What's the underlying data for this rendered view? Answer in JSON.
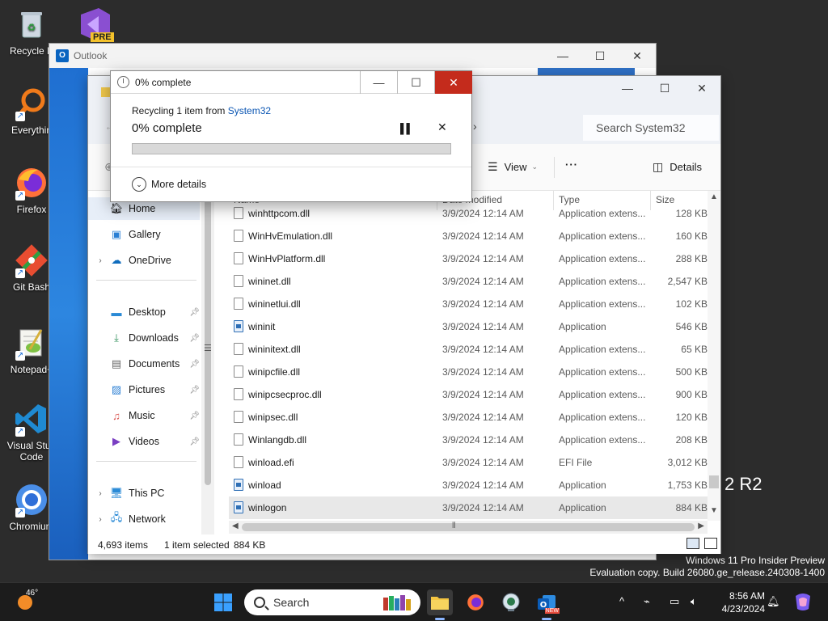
{
  "desktop": {
    "icons": [
      {
        "label": "Recycle B",
        "icon": "recycle-bin-icon"
      },
      {
        "label": "Everythin",
        "icon": "everything-search-icon"
      },
      {
        "label": "Firefox",
        "icon": "firefox-icon"
      },
      {
        "label": "Git Bash",
        "icon": "git-bash-icon"
      },
      {
        "label": "Notepad+",
        "icon": "notepad-plus-icon"
      },
      {
        "label": "Visual Stud Code",
        "icon": "vscode-icon"
      },
      {
        "label": "Chromium",
        "icon": "chromium-icon"
      }
    ],
    "vs_badge": "PRE",
    "background_text": "2 R2",
    "watermark": {
      "line1": "Windows 11 Pro Insider Preview",
      "line2": "Evaluation copy. Build 26080.ge_release.240308-1400"
    }
  },
  "outlook": {
    "title": "Outlook",
    "icon_letter": "O"
  },
  "explorer": {
    "search_placeholder": "Search System32",
    "toolbar": {
      "view_label": "View",
      "more_label": "···",
      "details_label": "Details"
    },
    "nav": {
      "home": "Home",
      "gallery": "Gallery",
      "onedrive": "OneDrive",
      "desktop": "Desktop",
      "downloads": "Downloads",
      "documents": "Documents",
      "pictures": "Pictures",
      "music": "Music",
      "videos": "Videos",
      "thispc": "This PC",
      "network": "Network"
    },
    "columns": {
      "name": "Name",
      "date": "Date modified",
      "type": "Type",
      "size": "Size"
    },
    "files": [
      {
        "name": "winhttpcom.dll",
        "date": "3/9/2024 12:14 AM",
        "type": "Application extens...",
        "size": "128 KB",
        "kind": "dll"
      },
      {
        "name": "WinHvEmulation.dll",
        "date": "3/9/2024 12:14 AM",
        "type": "Application extens...",
        "size": "160 KB",
        "kind": "dll"
      },
      {
        "name": "WinHvPlatform.dll",
        "date": "3/9/2024 12:14 AM",
        "type": "Application extens...",
        "size": "288 KB",
        "kind": "dll"
      },
      {
        "name": "wininet.dll",
        "date": "3/9/2024 12:14 AM",
        "type": "Application extens...",
        "size": "2,547 KB",
        "kind": "dll"
      },
      {
        "name": "wininetlui.dll",
        "date": "3/9/2024 12:14 AM",
        "type": "Application extens...",
        "size": "102 KB",
        "kind": "dll"
      },
      {
        "name": "wininit",
        "date": "3/9/2024 12:14 AM",
        "type": "Application",
        "size": "546 KB",
        "kind": "app"
      },
      {
        "name": "wininitext.dll",
        "date": "3/9/2024 12:14 AM",
        "type": "Application extens...",
        "size": "65 KB",
        "kind": "dll"
      },
      {
        "name": "winipcfile.dll",
        "date": "3/9/2024 12:14 AM",
        "type": "Application extens...",
        "size": "500 KB",
        "kind": "dll"
      },
      {
        "name": "winipcsecproc.dll",
        "date": "3/9/2024 12:14 AM",
        "type": "Application extens...",
        "size": "900 KB",
        "kind": "dll"
      },
      {
        "name": "winipsec.dll",
        "date": "3/9/2024 12:14 AM",
        "type": "Application extens...",
        "size": "120 KB",
        "kind": "dll"
      },
      {
        "name": "Winlangdb.dll",
        "date": "3/9/2024 12:14 AM",
        "type": "Application extens...",
        "size": "208 KB",
        "kind": "dll"
      },
      {
        "name": "winload.efi",
        "date": "3/9/2024 12:14 AM",
        "type": "EFI File",
        "size": "3,012 KB",
        "kind": "file"
      },
      {
        "name": "winload",
        "date": "3/9/2024 12:14 AM",
        "type": "Application",
        "size": "1,753 KB",
        "kind": "app"
      },
      {
        "name": "winlogon",
        "date": "3/9/2024 12:14 AM",
        "type": "Application",
        "size": "884 KB",
        "kind": "app",
        "selected": true
      }
    ],
    "status": {
      "items": "4,693 items",
      "selected": "1 item selected",
      "size": "884 KB"
    }
  },
  "dialog": {
    "title": "0% complete",
    "recycling_prefix": "Recycling 1 item from ",
    "recycling_source": "System32",
    "status": "0% complete",
    "progress_percent": 0,
    "more_details": "More details",
    "progress_color": "#06b025"
  },
  "taskbar": {
    "weather_temp": "46°",
    "search_placeholder": "Search",
    "time": "8:56 AM",
    "date": "4/23/2024",
    "new_badge": "NEW"
  }
}
